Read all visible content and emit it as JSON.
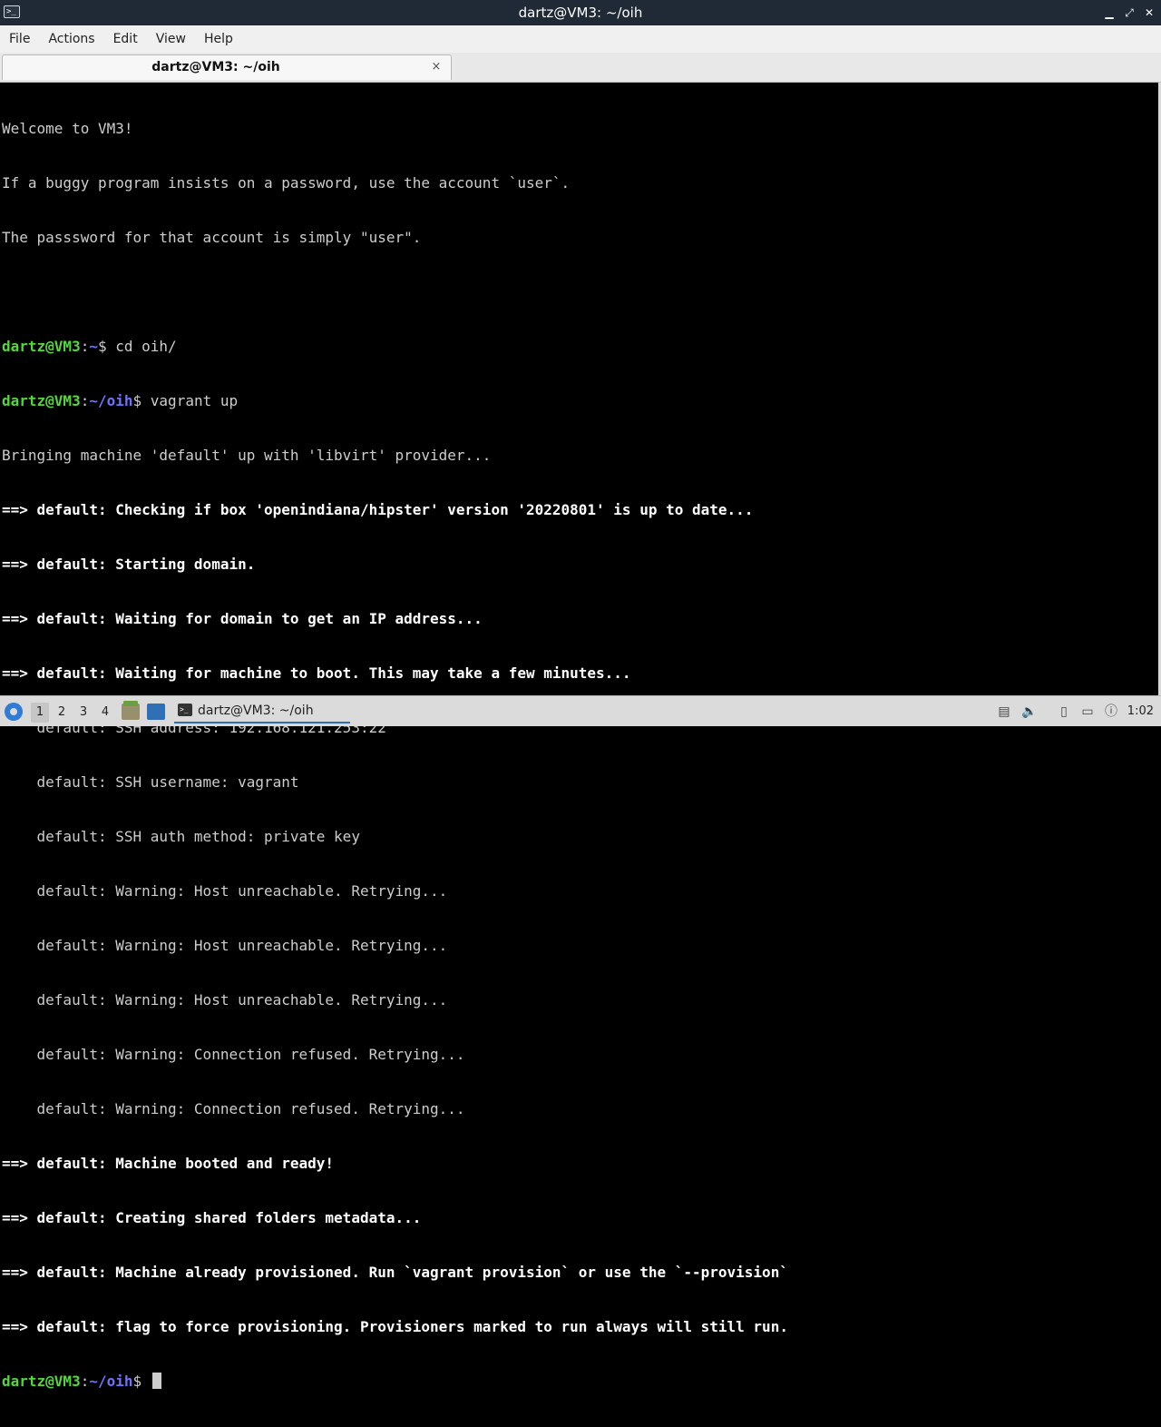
{
  "window": {
    "title": "dartz@VM3: ~/oih",
    "controls": {
      "minimize": "▁",
      "maximize": "⤢",
      "close": "✕"
    }
  },
  "menu": [
    "File",
    "Actions",
    "Edit",
    "View",
    "Help"
  ],
  "tab": {
    "label": "dartz@VM3: ~/oih",
    "close": "×"
  },
  "terminal": {
    "welcome": [
      "Welcome to VM3!",
      "If a buggy program insists on a password, use the account `user`.",
      "The passsword for that account is simply \"user\"."
    ],
    "prompt1": {
      "user": "dartz@VM3",
      "sep": ":",
      "path": "~",
      "dollar": "$",
      "cmd": " cd oih/"
    },
    "prompt2": {
      "user": "dartz@VM3",
      "sep": ":",
      "path": "~/oih",
      "dollar": "$",
      "cmd": " vagrant up"
    },
    "bringing": "Bringing machine 'default' up with 'libvirt' provider...",
    "bold_lines_1": [
      "==> default: Checking if box 'openindiana/hipster' version '20220801' is up to date...",
      "==> default: Starting domain.",
      "==> default: Waiting for domain to get an IP address...",
      "==> default: Waiting for machine to boot. This may take a few minutes..."
    ],
    "detail_lines": [
      "    default: SSH address: 192.168.121.253:22",
      "    default: SSH username: vagrant",
      "    default: SSH auth method: private key",
      "    default: Warning: Host unreachable. Retrying...",
      "    default: Warning: Host unreachable. Retrying...",
      "    default: Warning: Host unreachable. Retrying...",
      "    default: Warning: Connection refused. Retrying...",
      "    default: Warning: Connection refused. Retrying..."
    ],
    "bold_lines_2": [
      "==> default: Machine booted and ready!",
      "==> default: Creating shared folders metadata...",
      "==> default: Machine already provisioned. Run `vagrant provision` or use the `--provision`",
      "==> default: flag to force provisioning. Provisioners marked to run always will still run."
    ],
    "prompt3": {
      "user": "dartz@VM3",
      "sep": ":",
      "path": "~/oih",
      "dollar": "$",
      "cmd": " "
    }
  },
  "taskbar": {
    "workspaces": [
      "1",
      "2",
      "3",
      "4"
    ],
    "active_workspace": "1",
    "task_label": "dartz@VM3: ~/oih",
    "clock": "1:02"
  },
  "colors": {
    "prompt_user": "#54d839",
    "prompt_path": "#6e73ff",
    "titlebar": "#1f2a36"
  }
}
